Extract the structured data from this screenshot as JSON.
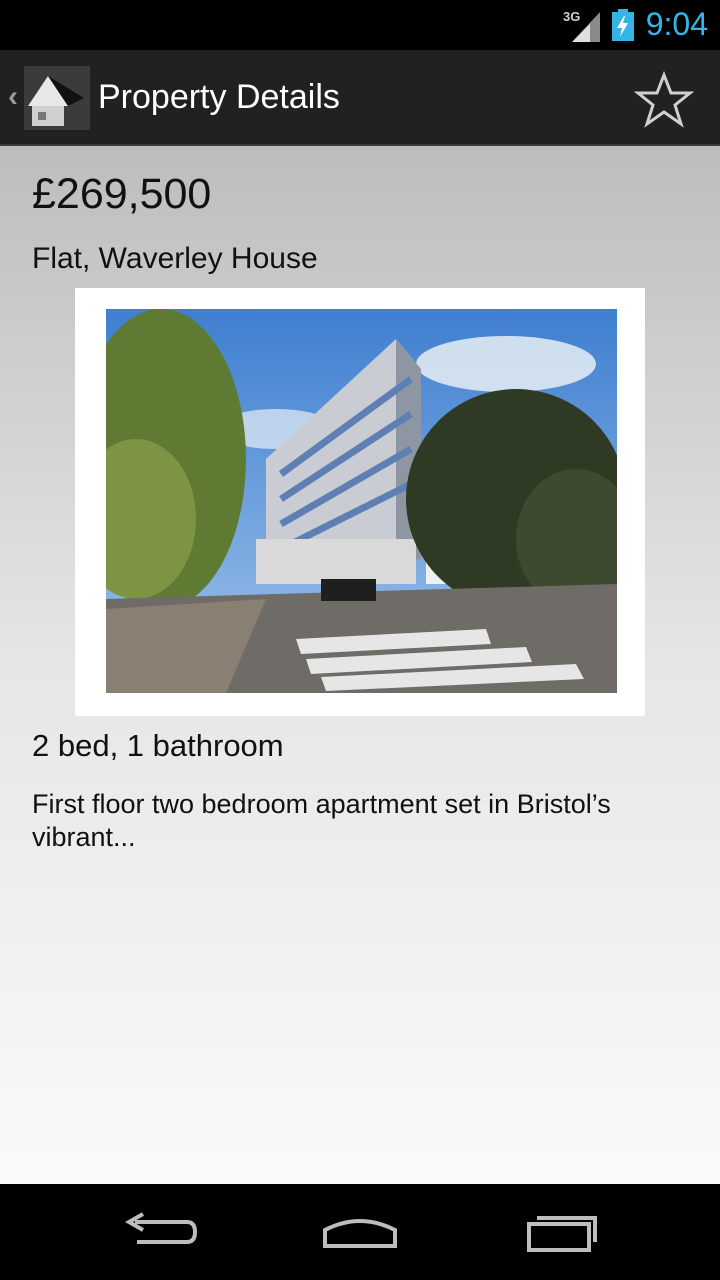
{
  "status_bar": {
    "network": "3G",
    "time": "9:04",
    "icons": [
      "signal-icon",
      "battery-charging-icon"
    ],
    "time_color": "#33b5e5"
  },
  "action_bar": {
    "title": "Property Details",
    "icons": [
      "up-caret-icon",
      "house-app-icon",
      "star-outline-icon"
    ]
  },
  "property": {
    "price": "£269,500",
    "address": "Flat, Waverley House",
    "rooms": "2 bed, 1 bathroom",
    "summary": "First floor two bedroom apartment set in Bristol’s vibrant..."
  },
  "nav_bar": {
    "icons": [
      "back-icon",
      "home-icon",
      "recent-apps-icon"
    ]
  }
}
